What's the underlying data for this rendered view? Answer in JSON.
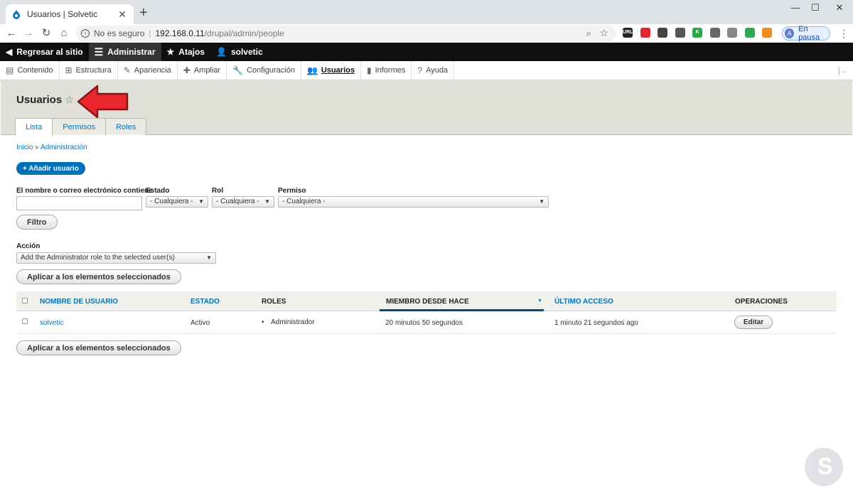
{
  "browser": {
    "tab_title": "Usuarios | Solvetic",
    "tab_close": "✕",
    "new_tab": "+",
    "window_controls": [
      "—",
      "☐",
      "✕"
    ],
    "security_label": "No es seguro",
    "url_host": "192.168.0.11",
    "url_path": "/drupal/admin/people",
    "profile_initial": "A",
    "profile_status": "En pausa",
    "extensions": [
      {
        "name": "url-ext-icon",
        "text": "URL",
        "color": "#222222"
      },
      {
        "name": "opera-ext-icon",
        "text": "",
        "color": "#e0262e"
      },
      {
        "name": "bird-ext-icon",
        "text": "",
        "color": "#444444"
      },
      {
        "name": "copy-ext-icon",
        "text": "",
        "color": "#555555"
      },
      {
        "name": "k-ext-icon",
        "text": "K",
        "color": "#2aa845"
      },
      {
        "name": "pen-ext-icon",
        "text": "",
        "color": "#666666"
      },
      {
        "name": "bulb-ext-icon",
        "text": "",
        "color": "#888888"
      },
      {
        "name": "shield-ext-icon",
        "text": "",
        "color": "#32a852"
      },
      {
        "name": "orange-ext-icon",
        "text": "",
        "color": "#f08a24"
      }
    ]
  },
  "toolbar": {
    "back": "Regresar al sitio",
    "admin": "Administrar",
    "shortcuts": "Atajos",
    "user": "solvetic"
  },
  "admin_menu": [
    {
      "label": "Contenido",
      "icon": "file-icon",
      "glyph": "▤"
    },
    {
      "label": "Estructura",
      "icon": "sitemap-icon",
      "glyph": "⊞"
    },
    {
      "label": "Apariencia",
      "icon": "brush-icon",
      "glyph": "✎"
    },
    {
      "label": "Ampliar",
      "icon": "puzzle-icon",
      "glyph": "✚"
    },
    {
      "label": "Configuración",
      "icon": "wrench-icon",
      "glyph": "🔧"
    },
    {
      "label": "Usuarios",
      "icon": "people-icon",
      "glyph": "👥",
      "active": true
    },
    {
      "label": "Informes",
      "icon": "bar-chart-icon",
      "glyph": "▮"
    },
    {
      "label": "Ayuda",
      "icon": "help-icon",
      "glyph": "?"
    }
  ],
  "page": {
    "title": "Usuarios",
    "tabs": [
      {
        "label": "Lista",
        "active": true
      },
      {
        "label": "Permisos",
        "active": false
      },
      {
        "label": "Roles",
        "active": false
      }
    ],
    "breadcrumb": [
      "Inicio",
      "Administración"
    ],
    "breadcrumb_sep": "»",
    "add_button": "+ Añadir usuario"
  },
  "filters": {
    "name_label": "El nombre o correo electrónico contiene",
    "name_value": "",
    "status_label": "Estado",
    "status_value": "- Cualquiera -",
    "role_label": "Rol",
    "role_value": "- Cualquiera -",
    "permission_label": "Permiso",
    "permission_value": "- Cualquiera -",
    "filter_button": "Filtro"
  },
  "bulk": {
    "action_label": "Acción",
    "action_value": "Add the Administrator role to the selected user(s)",
    "apply_button": "Aplicar a los elementos seleccionados"
  },
  "table": {
    "headers": {
      "username": "NOMBRE DE USUARIO",
      "status": "ESTADO",
      "roles": "ROLES",
      "member_for": "MIEMBRO DESDE HACE",
      "last_access": "ÚLTIMO ACCESO",
      "operations": "OPERACIONES"
    },
    "rows": [
      {
        "username": "solvetic",
        "status": "Activo",
        "role": "Administrador",
        "member_for": "20 minutos 50 segundos",
        "last_access": "1 minuto 21 segundos ago",
        "operation": "Editar"
      }
    ]
  }
}
